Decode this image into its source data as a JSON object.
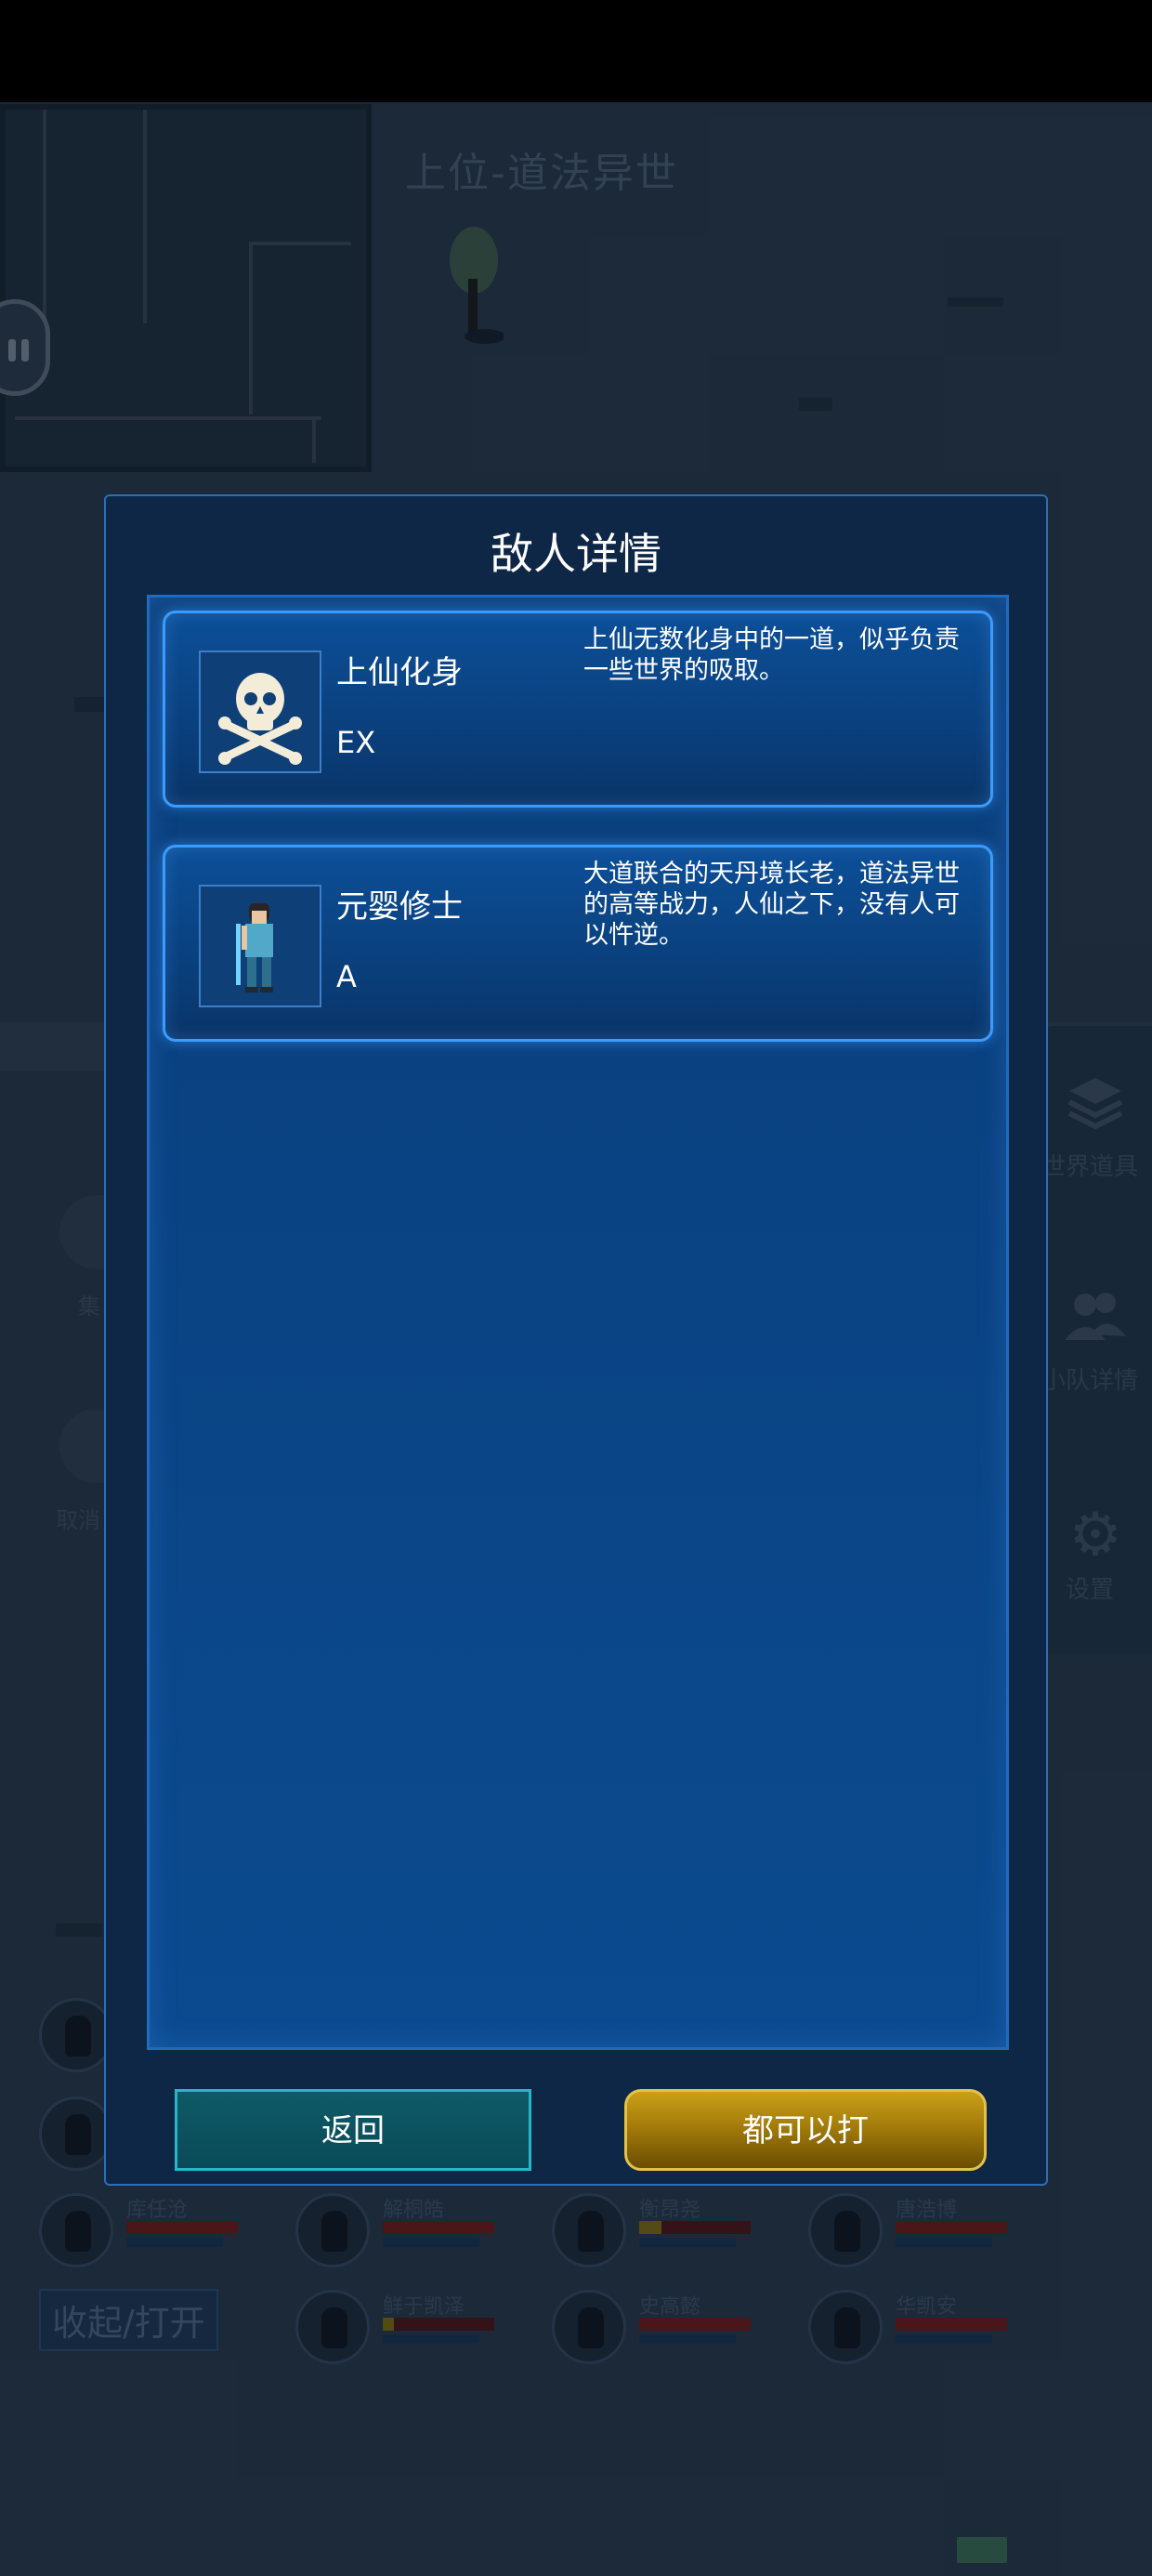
{
  "world": {
    "title": "上位-道法异世"
  },
  "side_panel": {
    "items": [
      {
        "label": "世界道具",
        "icon": "layers-icon"
      },
      {
        "label": "小队详情",
        "icon": "group-icon"
      },
      {
        "label": "设置",
        "icon": "gear-icon"
      }
    ]
  },
  "left_buttons": {
    "gather_label": "集",
    "cancel_label": "取消"
  },
  "team": {
    "collapse_label": "收起/打开",
    "members": [
      {
        "name": "库任沧",
        "hp": 1.0
      },
      {
        "name": "解桐皓",
        "hp": 1.0
      },
      {
        "name": "衡昂尧",
        "hp": 0.2
      },
      {
        "name": "唐浩博",
        "hp": 1.0
      },
      {
        "name": "鲜于凯泽",
        "hp": 0.1
      },
      {
        "name": "史高懿",
        "hp": 1.0
      },
      {
        "name": "华凯安",
        "hp": 1.0
      }
    ]
  },
  "modal": {
    "title": "敌人详情",
    "enemies": [
      {
        "name": "上仙化身",
        "rank": "EX",
        "description": "上仙无数化身中的一道，似乎负责一些世界的吸取。",
        "portrait": "skull-crossbones-icon"
      },
      {
        "name": "元婴修士",
        "rank": "A",
        "description": "大道联合的天丹境长老，道法异世的高等战力，人仙之下，没有人可以忤逆。",
        "portrait": "cultivator-sprite-icon"
      }
    ],
    "back_label": "返回",
    "fight_label": "都可以打"
  }
}
